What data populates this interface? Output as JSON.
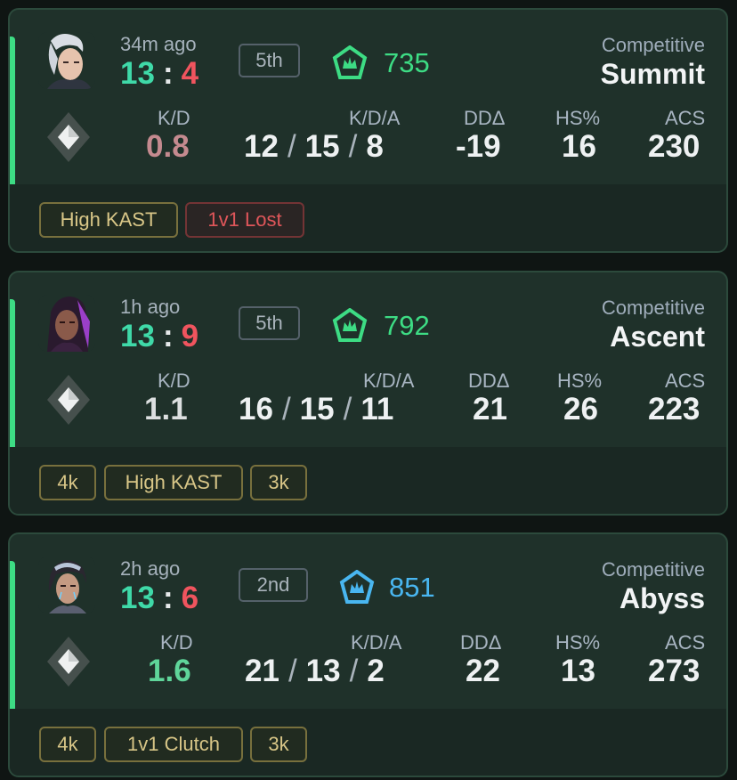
{
  "matches": [
    {
      "time": "34m ago",
      "score_won": "13",
      "score_sep": ":",
      "score_lost": "4",
      "placement": "5th",
      "rr": "735",
      "rank_color": "#3ddc84",
      "mode": "Competitive",
      "map": "Summit",
      "kd_label": "K/D",
      "kd_value": "0.8",
      "kd_color": "#c48a8f",
      "kda_label": "K/D/A",
      "kills": "12",
      "deaths": "15",
      "assists": "8",
      "kda_sep": "/",
      "dd_label": "DDΔ",
      "dd_value": "-19",
      "hs_label": "HS%",
      "hs_value": "16",
      "acs_label": "ACS",
      "acs_value": "230",
      "tags": [
        {
          "label": "High KAST",
          "style": "gold"
        },
        {
          "label": "1v1 Lost",
          "style": "red"
        }
      ]
    },
    {
      "time": "1h ago",
      "score_won": "13",
      "score_sep": ":",
      "score_lost": "9",
      "placement": "5th",
      "rr": "792",
      "rank_color": "#3ddc84",
      "mode": "Competitive",
      "map": "Ascent",
      "kd_label": "K/D",
      "kd_value": "1.1",
      "kd_color": "#dcdfe0",
      "kda_label": "K/D/A",
      "kills": "16",
      "deaths": "15",
      "assists": "11",
      "kda_sep": "/",
      "dd_label": "DDΔ",
      "dd_value": "21",
      "hs_label": "HS%",
      "hs_value": "26",
      "acs_label": "ACS",
      "acs_value": "223",
      "tags": [
        {
          "label": "4k",
          "style": "gold"
        },
        {
          "label": "High KAST",
          "style": "gold"
        },
        {
          "label": "3k",
          "style": "gold"
        }
      ]
    },
    {
      "time": "2h ago",
      "score_won": "13",
      "score_sep": ":",
      "score_lost": "6",
      "placement": "2nd",
      "rr": "851",
      "rank_color": "#49b6f0",
      "mode": "Competitive",
      "map": "Abyss",
      "kd_label": "K/D",
      "kd_value": "1.6",
      "kd_color": "#5fd59a",
      "kda_label": "K/D/A",
      "kills": "21",
      "deaths": "13",
      "assists": "2",
      "kda_sep": "/",
      "dd_label": "DDΔ",
      "dd_value": "22",
      "hs_label": "HS%",
      "hs_value": "13",
      "acs_label": "ACS",
      "acs_value": "273",
      "tags": [
        {
          "label": "4k",
          "style": "gold"
        },
        {
          "label": "1v1 Clutch",
          "style": "gold"
        },
        {
          "label": "3k",
          "style": "gold"
        }
      ]
    }
  ]
}
